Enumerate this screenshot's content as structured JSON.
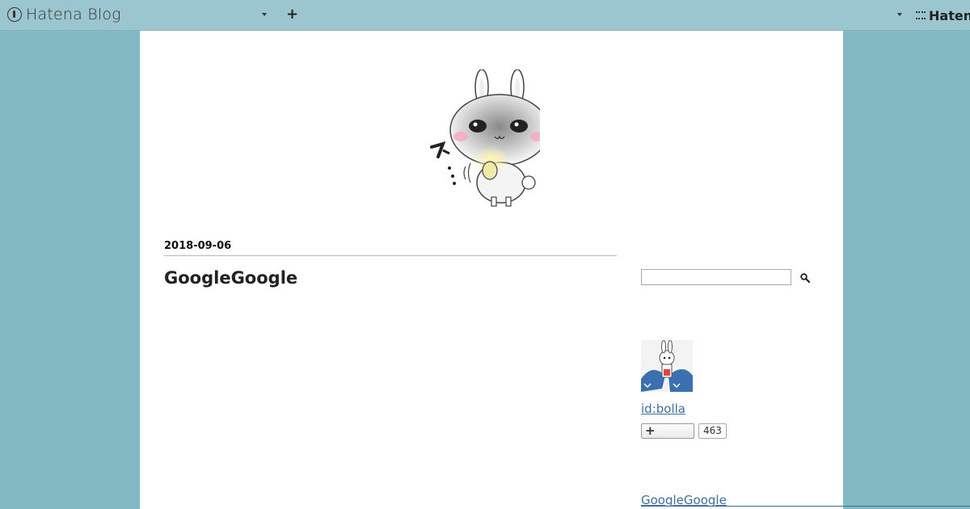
{
  "navbar": {
    "brand": "Hatena Blog",
    "add_label": "+",
    "hatena_label": "Hatena"
  },
  "header": {
    "image_icon": "rabbit-illustration"
  },
  "entry": {
    "date": "2018-09-06",
    "title": "GoogleGoogle"
  },
  "sidebar": {
    "search": {
      "placeholder": "",
      "icon": "search-icon"
    },
    "profile": {
      "avatar_icon": "rabbit-shark-avatar",
      "id_label": "id:bolla",
      "subscribe_label": "+",
      "subscriber_count": "463"
    },
    "recent_entry": "GoogleGoogle"
  },
  "colors": {
    "background": "#82b9c3",
    "navbar": "#9bc6cf",
    "link": "#3d6e9e"
  }
}
